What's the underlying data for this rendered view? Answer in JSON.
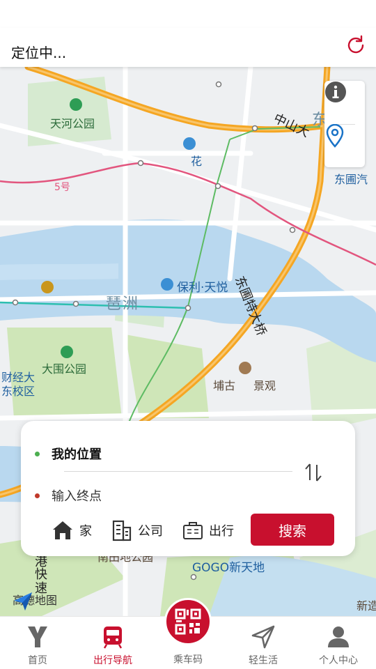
{
  "header": {
    "locating_text": "定位中..."
  },
  "map": {
    "labels": {
      "tianhe_park": "天河公园",
      "hua": "花",
      "east": "东",
      "zhongshan_road": "中山大",
      "donghui": "东圃汽",
      "line5": "5号",
      "dongpu_bridge": "东圃特大桥",
      "poly": "保利·天悦",
      "pazhou": "琶洲",
      "dawei_park": "大围公园",
      "finance_campus_1": "财经大",
      "finance_campus_2": "东校区",
      "pugu": "埔古",
      "jingguan": "景观",
      "gogo": "GOGO新天地",
      "express_1": "港",
      "express_2": "快",
      "express_3": "速",
      "xinjin": "新造",
      "bottom_park": "南田地公园"
    },
    "logo_text": "高德地图",
    "colors": {
      "water": "#b9d8ef",
      "green": "#cfe6b8",
      "highway": "#f5a623",
      "metro_pink": "#e2557e",
      "metro_teal": "#2dbfb0",
      "metro_green": "#5dbb63"
    }
  },
  "route_panel": {
    "origin": "我的位置",
    "destination_placeholder": "输入终点",
    "quick_links": {
      "home": "家",
      "company": "公司",
      "travel": "出行"
    },
    "search_button": "搜索",
    "colors": {
      "origin_dot": "#4caf50",
      "destination_dot": "#c0392b",
      "accent": "#c8102e"
    }
  },
  "tabbar": {
    "items": [
      {
        "label": "首页",
        "icon": "home-y-icon"
      },
      {
        "label": "出行导航",
        "icon": "train-icon"
      },
      {
        "label": "乘车码",
        "icon": "qr-code-icon"
      },
      {
        "label": "轻生活",
        "icon": "send-icon"
      },
      {
        "label": "个人中心",
        "icon": "user-icon"
      }
    ],
    "active_index": 1
  }
}
